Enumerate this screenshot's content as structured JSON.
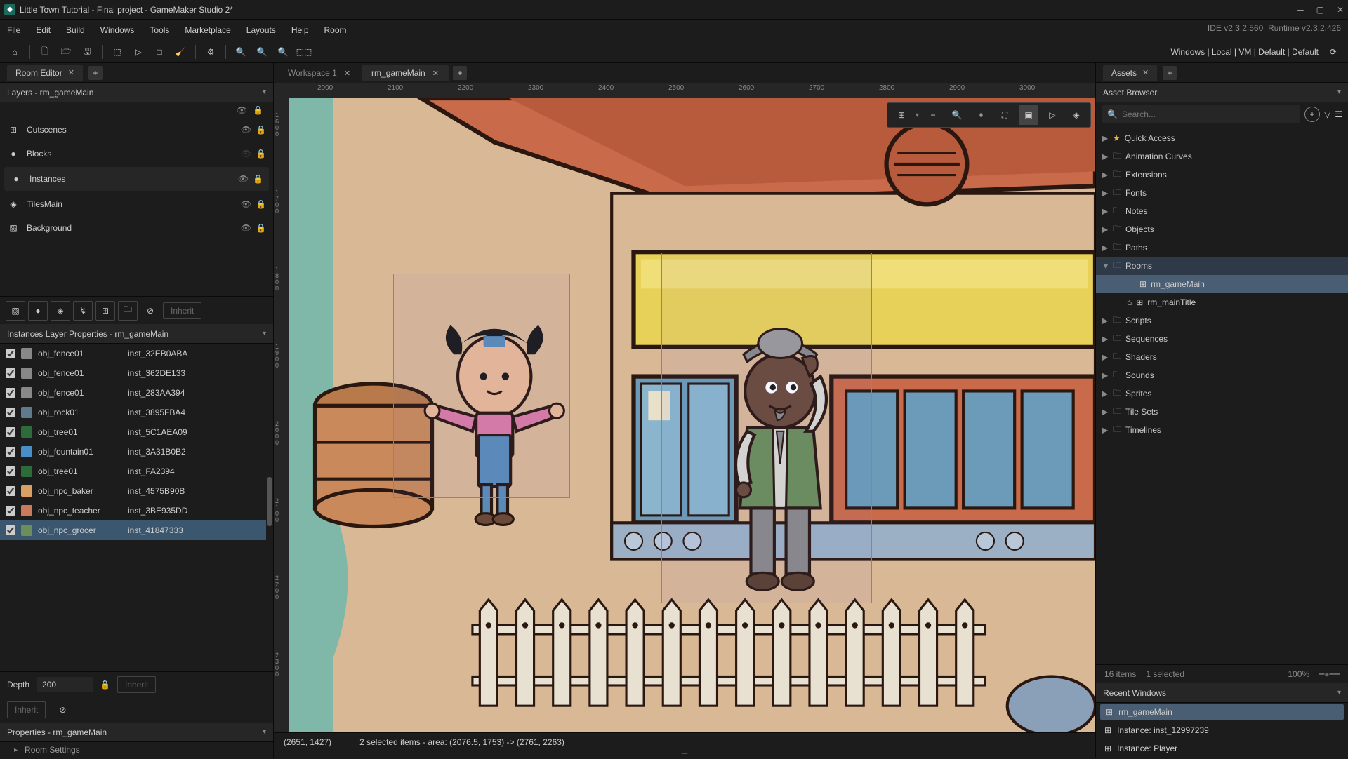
{
  "window": {
    "title": "Little Town Tutorial - Final project - GameMaker Studio 2*",
    "ide_version": "IDE v2.3.2.560",
    "runtime_version": "Runtime v2.3.2.426"
  },
  "menubar": [
    "File",
    "Edit",
    "Build",
    "Windows",
    "Tools",
    "Marketplace",
    "Layouts",
    "Help",
    "Room"
  ],
  "target_bar": "Windows | Local | VM | Default | Default",
  "left_panel": {
    "tab": "Room Editor",
    "layers_header": "Layers - rm_gameMain",
    "layers": [
      {
        "name": "Cutscenes",
        "icon": "cutscene",
        "vis": true,
        "lock": true
      },
      {
        "name": "Blocks",
        "icon": "circle",
        "vis": false,
        "lock": true
      },
      {
        "name": "Instances",
        "icon": "circle",
        "vis": true,
        "lock": true,
        "selected": true
      },
      {
        "name": "TilesMain",
        "icon": "tiles",
        "vis": true,
        "lock": true
      },
      {
        "name": "Background",
        "icon": "image",
        "vis": true,
        "lock": true
      }
    ],
    "layer_inherit": "Inherit",
    "instances_header": "Instances Layer Properties - rm_gameMain",
    "instances": [
      {
        "obj": "obj_fence01",
        "inst": "inst_32EB0ABA",
        "color": "#888"
      },
      {
        "obj": "obj_fence01",
        "inst": "inst_362DE133",
        "color": "#888"
      },
      {
        "obj": "obj_fence01",
        "inst": "inst_283AA394",
        "color": "#888"
      },
      {
        "obj": "obj_rock01",
        "inst": "inst_3895FBA4",
        "color": "#5f7a8c"
      },
      {
        "obj": "obj_tree01",
        "inst": "inst_5C1AEA09",
        "color": "#2e6b3a"
      },
      {
        "obj": "obj_fountain01",
        "inst": "inst_3A31B0B2",
        "color": "#4a8ec9"
      },
      {
        "obj": "obj_tree01",
        "inst": "inst_FA2394",
        "color": "#2e6b3a"
      },
      {
        "obj": "obj_npc_baker",
        "inst": "inst_4575B90B",
        "color": "#d9a066"
      },
      {
        "obj": "obj_npc_teacher",
        "inst": "inst_3BE935DD",
        "color": "#c97b5a"
      },
      {
        "obj": "obj_npc_grocer",
        "inst": "inst_41847333",
        "color": "#6b8e5a",
        "selected": true
      }
    ],
    "depth_label": "Depth",
    "depth_value": "200",
    "depth_inherit": "Inherit",
    "inherit_btn": "Inherit",
    "props_header": "Properties - rm_gameMain",
    "room_settings": "Room Settings"
  },
  "center": {
    "tabs": [
      {
        "label": "Workspace 1",
        "active": false
      },
      {
        "label": "rm_gameMain",
        "active": true
      }
    ],
    "ruler_h": [
      "2000",
      "2100",
      "2200",
      "2300",
      "2400",
      "2500",
      "2600",
      "2700",
      "2800",
      "2900",
      "3000"
    ],
    "ruler_v": [
      "1600",
      "1700",
      "1800",
      "1900",
      "2000",
      "2100",
      "2200",
      "2300"
    ],
    "status_coords": "(2651, 1427)",
    "status_selection": "2 selected items - area: (2076.5, 1753) -> (2761, 2263)"
  },
  "right_panel": {
    "tab": "Assets",
    "header": "Asset Browser",
    "search_placeholder": "Search...",
    "tree": [
      {
        "label": "Quick Access",
        "type": "star",
        "expand": "▶"
      },
      {
        "label": "Animation Curves",
        "type": "folder",
        "expand": "▶"
      },
      {
        "label": "Extensions",
        "type": "folder",
        "expand": "▶"
      },
      {
        "label": "Fonts",
        "type": "folder",
        "expand": "▶"
      },
      {
        "label": "Notes",
        "type": "folder",
        "expand": "▶"
      },
      {
        "label": "Objects",
        "type": "folder",
        "expand": "▶"
      },
      {
        "label": "Paths",
        "type": "folder",
        "expand": "▶"
      },
      {
        "label": "Rooms",
        "type": "folder",
        "expand": "▼",
        "hl": true,
        "children": [
          {
            "label": "rm_gameMain",
            "icon": "room",
            "selected": true
          },
          {
            "label": "rm_mainTitle",
            "icon": "room",
            "home": true
          }
        ]
      },
      {
        "label": "Scripts",
        "type": "folder",
        "expand": "▶"
      },
      {
        "label": "Sequences",
        "type": "folder",
        "expand": "▶"
      },
      {
        "label": "Shaders",
        "type": "folder",
        "expand": "▶"
      },
      {
        "label": "Sounds",
        "type": "folder",
        "expand": "▶"
      },
      {
        "label": "Sprites",
        "type": "folder",
        "expand": "▶"
      },
      {
        "label": "Tile Sets",
        "type": "folder",
        "expand": "▶"
      },
      {
        "label": "Timelines",
        "type": "folder",
        "expand": "▶"
      }
    ],
    "footer_items": "16 items",
    "footer_selected": "1 selected",
    "footer_zoom": "100%",
    "recent_header": "Recent Windows",
    "recent": [
      {
        "label": "rm_gameMain",
        "icon": "room",
        "selected": true
      },
      {
        "label": "Instance: inst_12997239",
        "icon": "inst"
      },
      {
        "label": "Instance: Player",
        "icon": "inst"
      }
    ]
  }
}
